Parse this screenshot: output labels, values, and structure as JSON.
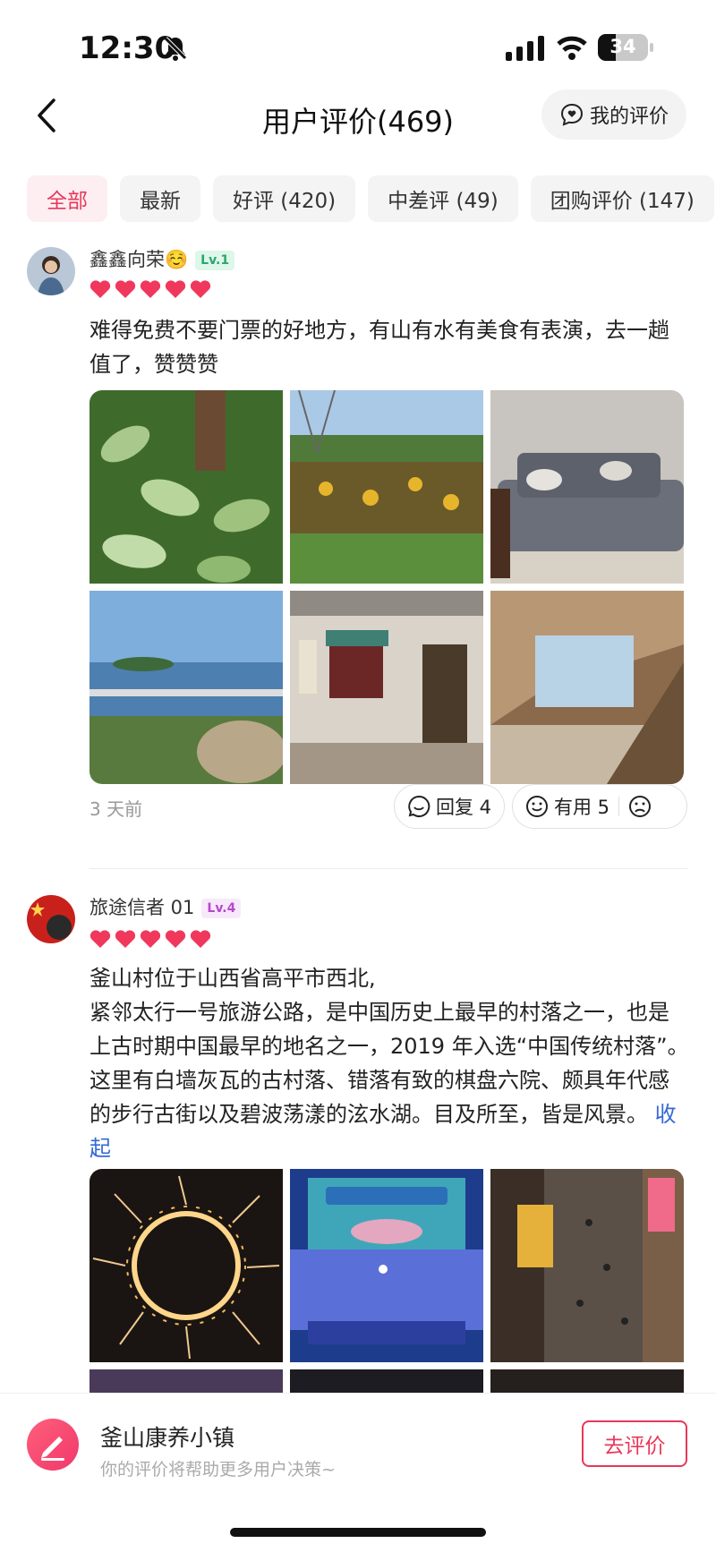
{
  "status_bar": {
    "time": "12:30",
    "battery": "34",
    "icons": [
      "bell-slash-icon",
      "signal-icon",
      "wifi-icon",
      "battery-icon"
    ]
  },
  "header": {
    "title": "用户评价(469)",
    "back_icon": "chevron-left-icon",
    "my_review_label": "我的评价",
    "my_review_icon": "heart-chat-icon"
  },
  "tabs": [
    {
      "label": "全部",
      "active": true
    },
    {
      "label": "最新",
      "active": false
    },
    {
      "label": "好评 (420)",
      "active": false
    },
    {
      "label": "中差评 (49)",
      "active": false
    },
    {
      "label": "团购评价 (147)",
      "active": false
    }
  ],
  "reviews": [
    {
      "user": "鑫鑫向荣☺️",
      "level": "Lv.1",
      "rating": 5,
      "text": "难得免费不要门票的好地方，有山有水有美食有表演，去一趟值了，赞赞赞",
      "photos": [
        "hosta-plants-photo",
        "flower-field-photo",
        "grey-sofa-photo",
        "lake-shore-photo",
        "interior-room-photo",
        "tent-deck-photo"
      ],
      "time_ago": "3 天前",
      "reply_label": "回复 4",
      "useful_label": "有用 5"
    },
    {
      "user": "旅途信者 01",
      "level": "Lv.4",
      "rating": 5,
      "text_lines": [
        "釜山村位于山西省高平市西北,",
        "紧邻太行一号旅游公路，是中国历史上最早的村落之一，也是上古时期中国最早的地名之一，2019 年入选“中国传统村落”。这里有白墙灰瓦的古村落、错落有致的棋盘六院、颇具年代感的步行古街以及碧波荡漾的泫水湖。目及所至，皆是风景。"
      ],
      "collapse_label": "收起",
      "photos": [
        "fireworks-ring-photo",
        "stage-show-photo",
        "street-night-photo"
      ]
    }
  ],
  "bottom_bar": {
    "shop_name": "釜山康养小镇",
    "hint": "你的评价将帮助更多用户决策~",
    "review_button": "去评价",
    "colors": {
      "accent": "#e8375a"
    }
  }
}
